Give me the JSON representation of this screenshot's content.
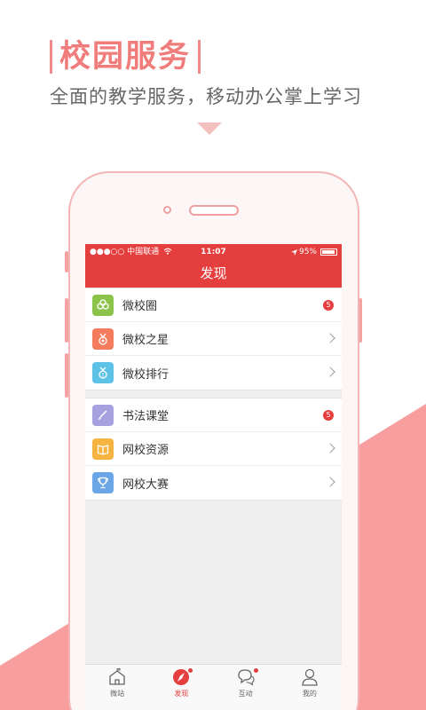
{
  "colors": {
    "brand_red": "#e53e3e",
    "accent_pink": "#f07c7c",
    "background_pink": "#f89e9e"
  },
  "promo": {
    "title": "校园服务",
    "subtitle": "全面的教学服务，移动办公掌上学习"
  },
  "status_bar": {
    "carrier": "●●●○○ 中国联通",
    "time": "11:07",
    "battery": "95%"
  },
  "nav": {
    "title": "发现"
  },
  "menu_groups": [
    {
      "items": [
        {
          "label": "微校圈",
          "icon": "clover-icon",
          "icon_color": "#8cc34b",
          "badge": "5"
        },
        {
          "label": "微校之星",
          "icon": "medal-icon",
          "icon_color": "#f47b5e",
          "badge": null
        },
        {
          "label": "微校排行",
          "icon": "ranking-icon",
          "icon_color": "#5dc2e6",
          "badge": null
        }
      ]
    },
    {
      "items": [
        {
          "label": "书法课堂",
          "icon": "brush-icon",
          "icon_color": "#a7a1e0",
          "badge": "5"
        },
        {
          "label": "网校资源",
          "icon": "book-icon",
          "icon_color": "#f5b33f",
          "badge": null
        },
        {
          "label": "网校大赛",
          "icon": "trophy-icon",
          "icon_color": "#6aa6e6",
          "badge": null
        }
      ]
    }
  ],
  "tabs": [
    {
      "label": "微站",
      "icon": "school-icon",
      "active": false,
      "dot": false
    },
    {
      "label": "发现",
      "icon": "compass-icon",
      "active": true,
      "dot": true
    },
    {
      "label": "互动",
      "icon": "chat-icon",
      "active": false,
      "dot": true
    },
    {
      "label": "我的",
      "icon": "person-icon",
      "active": false,
      "dot": false
    }
  ]
}
